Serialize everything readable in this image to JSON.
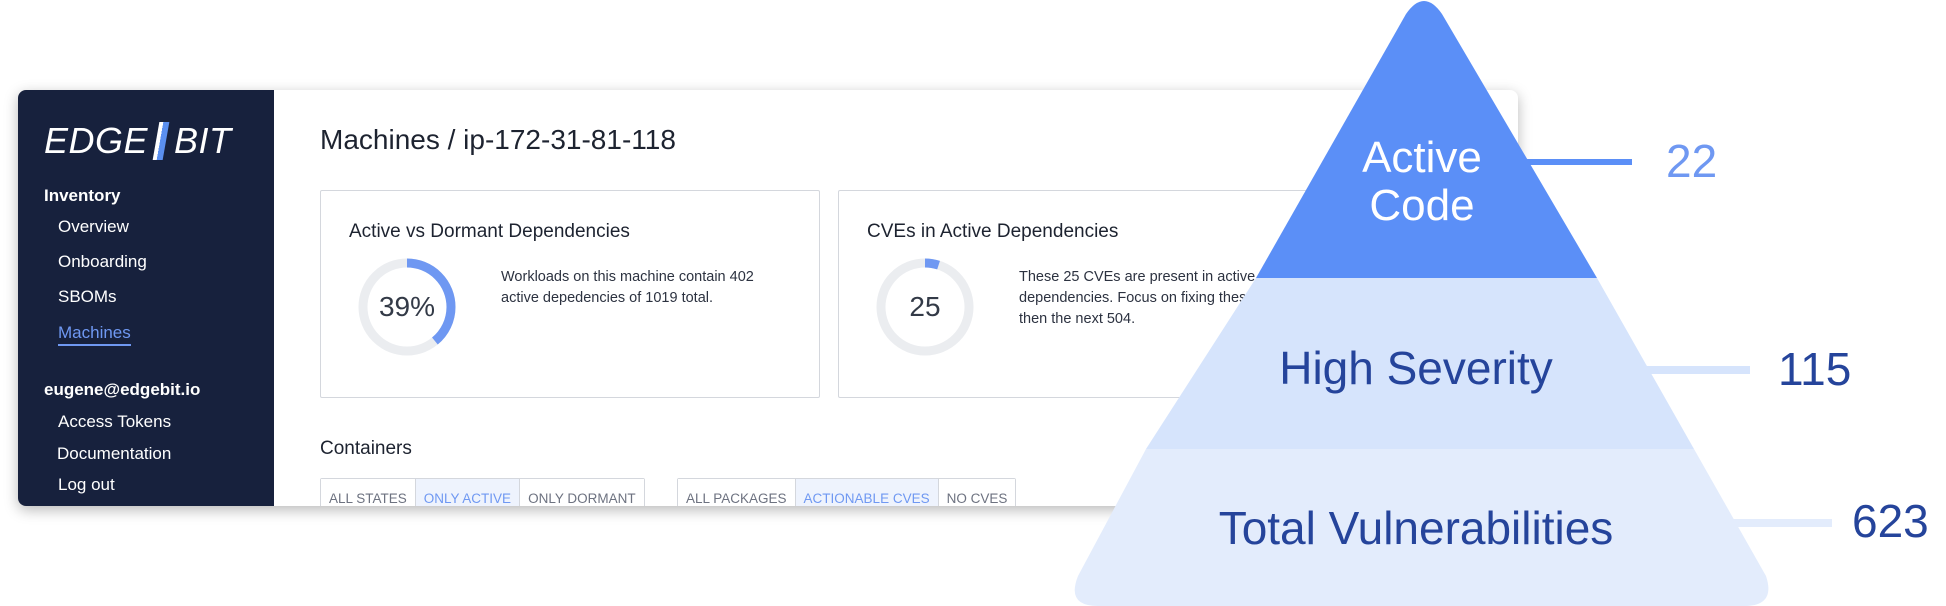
{
  "sidebar": {
    "logo_left": "EDGE",
    "logo_right": "BIT",
    "sections": [
      {
        "title": "Inventory",
        "items": [
          {
            "label": "Overview",
            "active": false
          },
          {
            "label": "Onboarding",
            "active": false
          },
          {
            "label": "SBOMs",
            "active": false
          },
          {
            "label": "Machines",
            "active": true
          }
        ]
      },
      {
        "title": "eugene@edgebit.io",
        "items": [
          {
            "label": "Access Tokens",
            "active": false
          },
          {
            "label": "Documentation",
            "active": false
          },
          {
            "label": "Log out",
            "active": false
          }
        ]
      }
    ]
  },
  "main": {
    "title": "Machines / ip-172-31-81-118",
    "cards": [
      {
        "title": "Active vs Dormant Dependencies",
        "donut_value": "39%",
        "donut_fraction": 0.39,
        "description": "Workloads on this machine contain 402 active depedencies of 1019 total."
      },
      {
        "title": "CVEs in Active Dependencies",
        "donut_value": "25",
        "donut_fraction": 0.05,
        "description": "These 25 CVEs are present in active dependencies. Focus on fixing these first, then the next 504."
      }
    ],
    "containers_title": "Containers",
    "state_filters": [
      {
        "label": "ALL STATES",
        "selected": false
      },
      {
        "label": "ONLY ACTIVE",
        "selected": true
      },
      {
        "label": "ONLY DORMANT",
        "selected": false
      }
    ],
    "package_filters": [
      {
        "label": "ALL PACKAGES",
        "selected": false
      },
      {
        "label": "ACTIONABLE CVES",
        "selected": true
      },
      {
        "label": "NO CVES",
        "selected": false
      }
    ]
  },
  "pyramid": {
    "tiers": [
      {
        "label_lines": [
          "Active",
          "Code"
        ],
        "count": "22"
      },
      {
        "label_lines": [
          "High Severity"
        ],
        "count": "115"
      },
      {
        "label_lines": [
          "Total Vulnerabilities"
        ],
        "count": "623"
      }
    ]
  },
  "colors": {
    "sidebar_bg": "#17213d",
    "accent": "#6f98f2",
    "tier_top": "#5b8ff7",
    "tier_mid": "#d6e4fc",
    "tier_bottom": "#e3ecfc",
    "dark_text": "#25449b",
    "donut_track": "#ebedf0"
  }
}
